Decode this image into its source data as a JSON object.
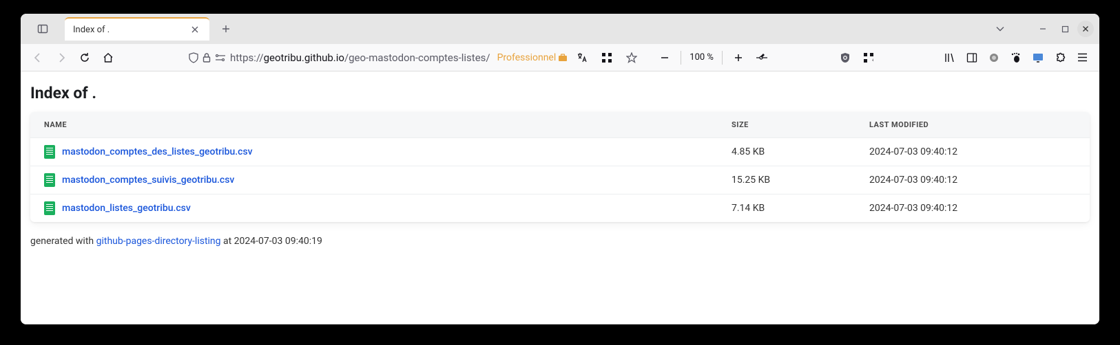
{
  "tab": {
    "title": "Index of ."
  },
  "url": {
    "scheme": "https://",
    "host": "geotribu.github.io",
    "path": "/geo-mastodon-comptes-listes/"
  },
  "context_label": "Professionnel",
  "zoom": "100 %",
  "page": {
    "heading": "Index of .",
    "columns": {
      "name": "Name",
      "size": "Size",
      "modified": "Last Modified"
    },
    "files": [
      {
        "name": "mastodon_comptes_des_listes_geotribu.csv",
        "size": "4.85 KB",
        "modified": "2024-07-03 09:40:12"
      },
      {
        "name": "mastodon_comptes_suivis_geotribu.csv",
        "size": "15.25 KB",
        "modified": "2024-07-03 09:40:12"
      },
      {
        "name": "mastodon_listes_geotribu.csv",
        "size": "7.14 KB",
        "modified": "2024-07-03 09:40:12"
      }
    ],
    "footer": {
      "prefix": "generated with ",
      "link_text": "github-pages-directory-listing",
      "suffix": " at 2024-07-03 09:40:19"
    }
  }
}
